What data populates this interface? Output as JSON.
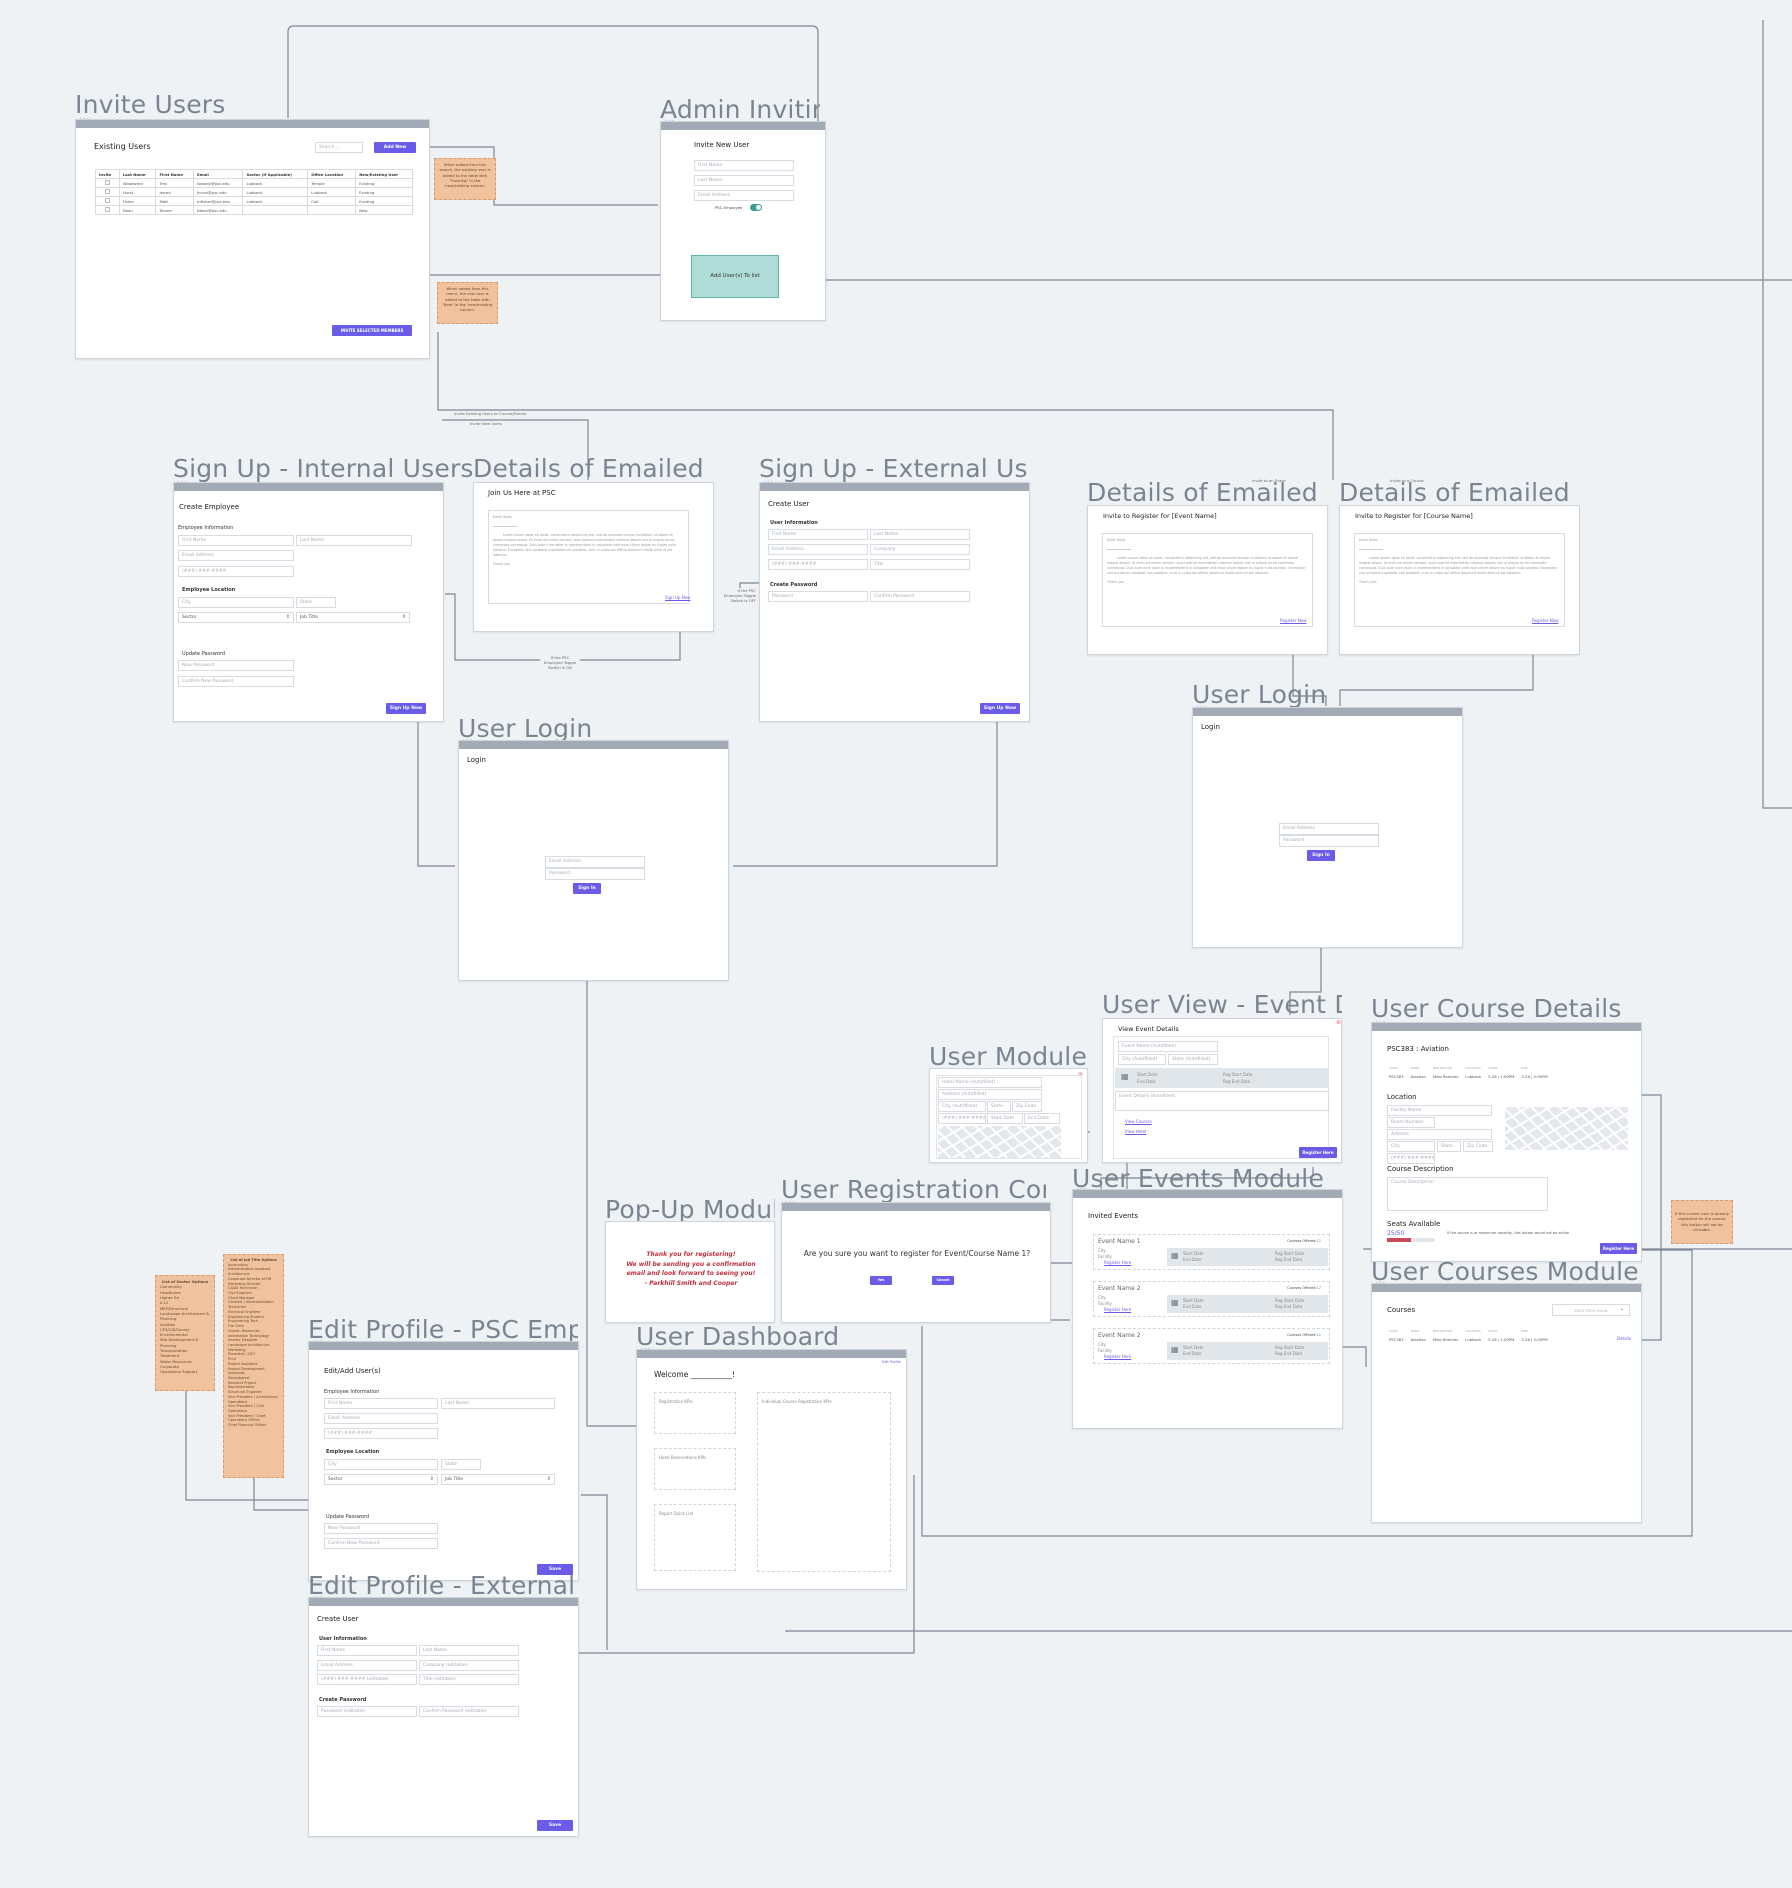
{
  "screens": {
    "invite_users": {
      "title": "Invite Users",
      "heading": "Existing Users",
      "search_placeholder": "Search...",
      "add_new": "Add New",
      "columns": [
        "Invite",
        "Last Name",
        "First Name",
        "Email",
        "Sector (If Applicable)",
        "Office Location",
        "New/Existing User"
      ],
      "rows": [
        [
          "",
          "Woodward",
          "Trey",
          "twoody@psc.edu",
          "Lubbock",
          "Temple",
          "Existing"
        ],
        [
          "",
          "Hurst",
          "Jerred",
          "jhurst@psc.edu",
          "Lubbock",
          "Lubbock",
          "Existing"
        ],
        [
          "",
          "Fisher",
          "Matt",
          "mfisher@psc.edu",
          "Lubbock",
          "Cali",
          "Existing"
        ],
        [
          "",
          "Dean",
          "Tanner",
          "tdean@psc.edu",
          "",
          "",
          "New"
        ]
      ],
      "invite_button": "INVITE SELECTED MEMBERS"
    },
    "notes": {
      "search_note": "When added from this search, the existing user is added to the table with \"Existing\" in the 'new/existing column.",
      "menu_note": "When added from this menu, the new user is added to the table with \"New\" in the 'new/existing' column.",
      "register_note": "If the current user is already registered for the course, this button will not be clickable.",
      "sector_title": "List of Sector Options",
      "sectors": [
        "Community",
        "Healthcare",
        "Higher Ed",
        "K-12",
        "MEP/Structural",
        "Landscape Architecture & Planning",
        "Aviation",
        "CPS/GIS/Survey",
        "Environmental",
        "Site Development & Planning",
        "Transportation",
        "Treatment",
        "Water Resources",
        "Corporate",
        "Operations Support"
      ],
      "jobtitle_title": "List of Job Title Options",
      "job_titles": [
        "Accounting",
        "Administrative Assistant",
        "Architecture",
        "Corporate Director of HR",
        "Marketing Director",
        "CADD Technician",
        "Civil Engineer",
        "Client Manager",
        "Controls / Implementation Technician",
        "Electrical Engineer",
        "Engineering Student",
        "Engineering Tech",
        "File Clerk",
        "Human Resources",
        "Information Technology",
        "Interior Designer",
        "Landscape Architecture",
        "Marketing",
        "President / CEO",
        "Print",
        "Project Assistant",
        "Project Development Specialist",
        "Receptionist",
        "Resident Project Representative",
        "Structural Engineer",
        "Vice President / Architecture Operations",
        "Vice President / Civil Operations",
        "Vice President / Chief Operations Officer",
        "Chief Financial Officer"
      ]
    },
    "admin_inviting": {
      "title": "Admin Inviting",
      "heading": "Invite New User",
      "first_name": "First Name",
      "last_name": "Last Name",
      "email": "Email Address",
      "psc_toggle_label": "PSC Employee",
      "psc_toggle_on": true,
      "add_button": "Add User(s) To list"
    },
    "flow_labels": {
      "invite_existing": "Invite Existing Users to Course/Events",
      "invite_new": "Invite New Users",
      "toggle_on": "If the PSC Employee Toggle Switch is ON",
      "toggle_off": "If the PSC Employee Toggle Switch is OFF",
      "invite_event": "Invite to an Event",
      "invite_course": "Invite to a Course",
      "capacity_note": "If the course is at maximum capacity, this button would not be active"
    },
    "signup_internal": {
      "title": "Sign Up - Internal Users",
      "heading": "Create Employee",
      "section_info": "Employee Information",
      "first_name": "First Name",
      "last_name": "Last Name",
      "email": "Email Address",
      "phone": "(###) ###-####",
      "section_location": "Employee Location",
      "city": "City",
      "state": "State",
      "sector": "Sector",
      "job_title": "Job Title",
      "section_password": "Update Password",
      "new_password": "New Password",
      "confirm_password": "Confirm New Password",
      "submit": "Sign Up Now"
    },
    "email_join": {
      "title": "Details of Emailed Invite",
      "heading": "Join Us Here at PSC",
      "body_label": "Email Body",
      "body": "Lorem ipsum dolor sit amet, consectetur adipiscing elit, sed do eiusmod tempor incididunt ut labore et dolore magna aliqua. Ut enim ad minim veniam, quis nostrud exercitation ullamco laboris nisi ut aliquip ex ea commodo consequat. Duis aute irure dolor in reprehenderit in voluptate velit esse cillum dolore eu fugiat nulla pariatur. Excepteur sint occaecat cupidatat non proident, sunt in culpa qui officia deserunt mollit anim id est laborum.",
      "thanks": "Thank you,",
      "link": "Sign Up Now"
    },
    "signup_external": {
      "title": "Sign Up - External Users",
      "heading": "Create User",
      "section_info": "User Information",
      "first_name": "First Name",
      "last_name": "Last Name",
      "email": "Email Address",
      "company": "Company",
      "phone": "(###) ###-####",
      "job_title": "Title",
      "section_password": "Create Password",
      "password": "Password",
      "confirm_password": "Confirm Password",
      "submit": "Sign Up Now"
    },
    "email_event": {
      "title": "Details of Emailed Invite",
      "heading": "Invite to Register for [Event Name]",
      "body_label": "Email Body",
      "thanks": "Thank you,",
      "link": "Register Now"
    },
    "email_course": {
      "title": "Details of Emailed Invite",
      "heading": "Invite to Register for [Course Name]",
      "body_label": "Email Body",
      "thanks": "Thank you,",
      "link": "Register Now"
    },
    "login1": {
      "title": "User Login",
      "heading": "Login",
      "email": "Email Address",
      "password": "Password",
      "submit": "Sign In"
    },
    "login2": {
      "title": "User Login",
      "heading": "Login",
      "email": "Email Address",
      "password": "Password",
      "submit": "Sign In"
    },
    "event_details": {
      "title": "User View - Event Details",
      "heading": "View Event Details",
      "event_name": "Event Name (Autofilled)",
      "city": "City (Autofilled)",
      "state": "State (Autofilled)",
      "start": "Start Date",
      "end": "End Date",
      "reg_start": "Reg Start Date",
      "reg_end": "Reg End Date",
      "details": "Event Details (Autofilled)",
      "view_courses": "View Courses",
      "view_hotel": "View Hotel",
      "register": "Register Here"
    },
    "hotel_module": {
      "title": "User Module of Hotel",
      "hotel_name": "Hotel Name (Autofilled)",
      "address": "Address (Autofilled)",
      "city": "City (Autofilled)",
      "state": "State",
      "zip": "Zip Code",
      "phone": "(###) ###-####",
      "start": "Start Date",
      "end": "End Date"
    },
    "course_details": {
      "title": "User Course Details",
      "heading": "PSC383 : Aviation",
      "columns": [
        "CODE",
        "NAME",
        "INSTRUCTOR",
        "LOCATION",
        "START",
        "END"
      ],
      "row": [
        "PSC383",
        "Aviation",
        "Mike Ramirez",
        "Lubbock",
        "5.26 | 1:00PM",
        "5.26 | 2:00PM"
      ],
      "location_heading": "Location",
      "facility": "Facility Name",
      "room": "Room Number",
      "address": "Address",
      "city": "City",
      "state": "State",
      "zip": "Zip Code",
      "phone": "(###) ###-####",
      "desc_heading": "Course Description",
      "desc_placeholder": "Course Description",
      "seats_heading": "Seats Available",
      "seats_text": "25/50",
      "seats_fraction": 0.5,
      "register": "Register Here"
    },
    "courses_module": {
      "title": "User Courses Module",
      "heading": "Courses",
      "dropdown": "2020 PSCU Event",
      "columns": [
        "CODE",
        "NAME",
        "INSTRUCTOR",
        "LOCATION",
        "START",
        "END"
      ],
      "row": [
        "PSC383",
        "Aviation",
        "Mike Ramirez",
        "Lubbock",
        "5.26 | 1:00PM",
        "5.26 | 2:00PM"
      ],
      "details_link": "Details"
    },
    "events_module": {
      "title": "User Events Module",
      "heading": "Invited Events",
      "events": [
        {
          "name": "Event Name 1",
          "city": "City",
          "facility": "Facility",
          "register": "Register Here",
          "courses_label": "Courses Offered:",
          "courses_count": "12",
          "start": "Start Date",
          "end": "End Date",
          "reg_start": "Reg Start Date",
          "reg_end": "Reg End Date"
        },
        {
          "name": "Event Name 2",
          "city": "City",
          "facility": "Facility",
          "register": "Register Here",
          "courses_label": "Courses Offered:",
          "courses_count": "12",
          "start": "Start Date",
          "end": "End Date",
          "reg_start": "Reg Start Date",
          "reg_end": "Reg End Date"
        },
        {
          "name": "Event Name 2",
          "city": "City",
          "facility": "Facility",
          "register": "Register Here",
          "courses_label": "Courses Offered:",
          "courses_count": "12",
          "start": "Start Date",
          "end": "End Date",
          "reg_start": "Reg Start Date",
          "reg_end": "Reg End Date"
        }
      ]
    },
    "popup": {
      "title": "Pop-Up Module",
      "message_lines": [
        "Thank you for registering!",
        "We will be sending you a confirmation",
        "email and look forward to seeing you!",
        "- Parkhill Smith and Cooper"
      ]
    },
    "confirm": {
      "title": "User Registration Confirmation",
      "question": "Are you sure you want to register for Event/Course Name 1?",
      "yes": "Yes",
      "cancel": "Cancel"
    },
    "dashboard": {
      "title": "User Dashboard",
      "welcome": "Welcome ___________!",
      "edit_profile": "Edit Profile",
      "reg_kpis": "Registration KPIs",
      "hotel_kpis": "Hotel Reservations KPIs",
      "report_list": "Report Quick List",
      "course_kpis": "Individual Course Registration KPIs"
    },
    "edit_internal": {
      "title": "Edit Profile - PSC Employee",
      "heading": "Edit/Add User(s)",
      "section_info": "Employee Information",
      "first_name": "First Name",
      "last_name": "Last Name",
      "email": "Email Address",
      "phone": "(###) ###-####",
      "section_location": "Employee Location",
      "city": "City",
      "state": "State",
      "sector": "Sector",
      "job_title": "Job Title",
      "section_password": "Update Password",
      "new_password": "New Password",
      "confirm_password": "Confirm New Password",
      "save": "Save"
    },
    "edit_external": {
      "title": "Edit Profile - External User",
      "heading": "Create User",
      "section_info": "User Information",
      "first_name": "First Name",
      "last_name": "Last Name",
      "email": "Email Address",
      "company": "Company (editable)",
      "phone": "(###) ###-#### (editable)",
      "job_title": "Title (editable)",
      "section_password": "Create Password",
      "password": "Password (editable)",
      "confirm_password": "Confirm Password (editable)",
      "save": "Save"
    }
  },
  "colors": {
    "accent": "#6a5ce8",
    "note": "#f0c29d",
    "teal": "#b0dcd8",
    "popup_text": "#c0303f",
    "seat_bar": "#c84a5a"
  }
}
